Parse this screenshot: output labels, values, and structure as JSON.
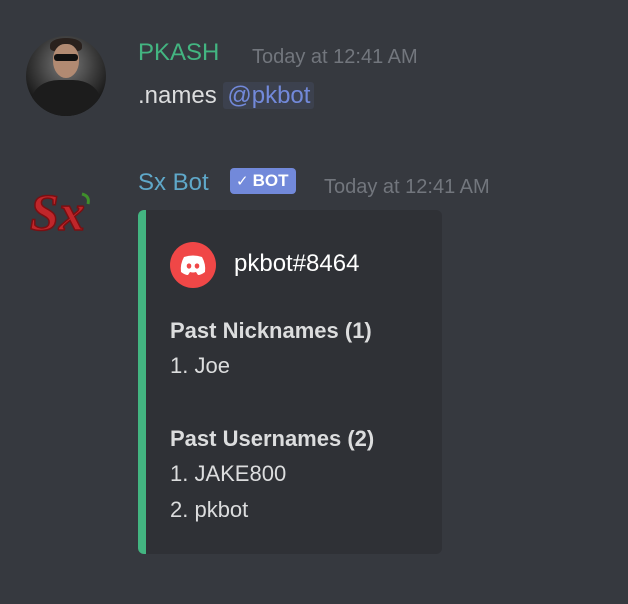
{
  "messages": [
    {
      "username": "PKASH",
      "timestamp": "Today at 12:41 AM",
      "content_text": ".names ",
      "mention": "@pkbot",
      "username_color": "#43b581"
    },
    {
      "username": "Sx Bot",
      "bot_tag": "BOT",
      "timestamp": "Today at 12:41 AM",
      "username_color": "#5fa8c9",
      "avatar_text": "Sx",
      "embed": {
        "accent_color": "#43b581",
        "author_name": "pkbot#8464",
        "author_icon": "discord-logo-icon",
        "fields": [
          {
            "name": "Past Nicknames (1)",
            "values": [
              "1. Joe"
            ]
          },
          {
            "name": "Past Usernames (2)",
            "values": [
              "1. JAKE800",
              "2. pkbot"
            ]
          }
        ]
      }
    }
  ]
}
